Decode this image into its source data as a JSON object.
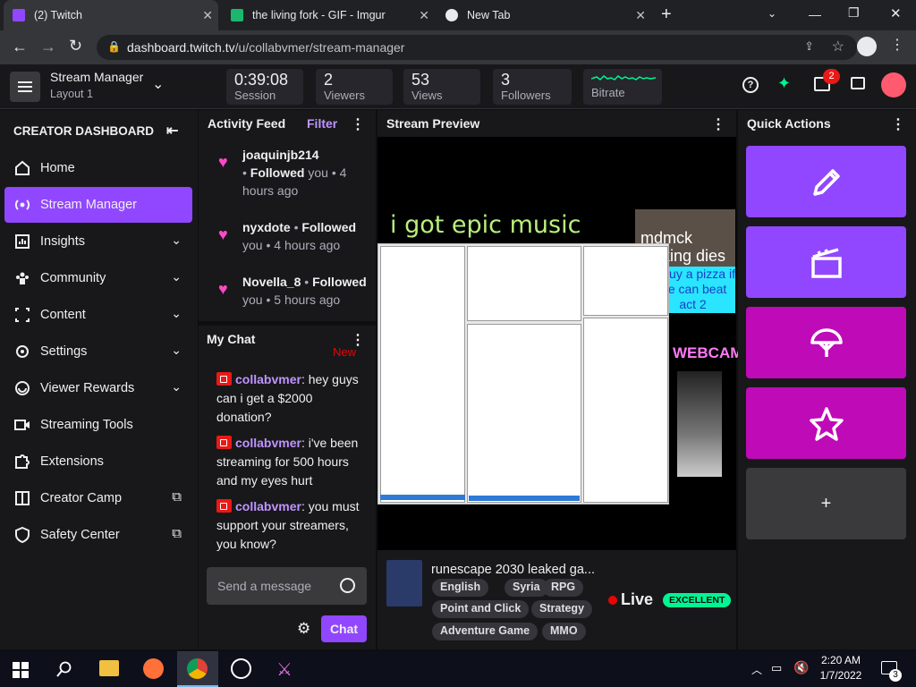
{
  "browser": {
    "tabs": [
      {
        "title": "(2) Twitch"
      },
      {
        "title": "the living fork - GIF - Imgur"
      },
      {
        "title": "New Tab"
      }
    ],
    "url_host": "dashboard.twitch.tv",
    "url_path": "/u/collabvmer/stream-manager"
  },
  "header": {
    "title": "Stream Manager",
    "subtitle": "Layout 1",
    "stats": [
      {
        "value": "0:39:08",
        "label": "Session"
      },
      {
        "value": "2",
        "label": "Viewers"
      },
      {
        "value": "53",
        "label": "Views"
      },
      {
        "value": "3",
        "label": "Followers"
      },
      {
        "value": "",
        "label": "Bitrate"
      }
    ],
    "notification_count": "2"
  },
  "sidebar": {
    "heading": "CREATOR DASHBOARD",
    "items": [
      {
        "label": "Home",
        "icon": "home-icon"
      },
      {
        "label": "Stream Manager",
        "icon": "broadcast-icon"
      },
      {
        "label": "Insights",
        "icon": "insights-icon"
      },
      {
        "label": "Community",
        "icon": "community-icon"
      },
      {
        "label": "Content",
        "icon": "content-icon"
      },
      {
        "label": "Settings",
        "icon": "gear-icon"
      },
      {
        "label": "Viewer Rewards",
        "icon": "rewards-icon"
      },
      {
        "label": "Streaming Tools",
        "icon": "camera-icon"
      },
      {
        "label": "Extensions",
        "icon": "puzzle-icon"
      },
      {
        "label": "Creator Camp",
        "icon": "book-icon"
      },
      {
        "label": "Safety Center",
        "icon": "shield-icon"
      }
    ]
  },
  "activity": {
    "title": "Activity Feed",
    "filter": "Filter",
    "items": [
      {
        "user": "joaquinjb214",
        "action": "Followed",
        "rest": " you",
        "time": "4 hours ago"
      },
      {
        "user": "nyxdote",
        "action": "Followed",
        "rest": " you",
        "time": "4 hours ago"
      },
      {
        "user": "Novella_8",
        "action": "Followed",
        "rest": " you",
        "time": "5 hours ago"
      }
    ]
  },
  "chat": {
    "title": "My Chat",
    "new_label": "New",
    "messages": [
      {
        "user": "collabvmer",
        "text": ": hey guys can i get a $2000 donation?"
      },
      {
        "user": "collabvmer",
        "text": ": i've been streaming for 500 hours and my eyes hurt"
      },
      {
        "user": "collabvmer",
        "text": ": you must support your streamers, you know?"
      }
    ],
    "placeholder": "Send a message",
    "send_label": "Chat"
  },
  "preview": {
    "title": "Stream Preview",
    "overlay_top": "i got epic music",
    "overlay_meme": "mdmck fucking dies",
    "overlay_pizza": "ill buy a pizza if we can beat act 2",
    "overlay_webcam": "WEBCAM",
    "stream_title": "runescape 2030 leaked ga...",
    "tags": [
      "English",
      "Syria",
      "RPG",
      "Point and Click",
      "Strategy",
      "Adventure Game",
      "MMO"
    ],
    "live_label": "Live",
    "health": "EXCELLENT"
  },
  "quick_actions": {
    "title": "Quick Actions",
    "add_label": "+",
    "actions": [
      {
        "icon": "pencil-icon",
        "color": "#9147ff"
      },
      {
        "icon": "clip-icon",
        "color": "#9147ff"
      },
      {
        "icon": "umbrella-icon",
        "color": "#bf0ab8"
      },
      {
        "icon": "star-icon",
        "color": "#bf0ab8"
      }
    ]
  },
  "taskbar": {
    "time": "2:20 AM",
    "date": "1/7/2022",
    "notif_count": "3"
  }
}
